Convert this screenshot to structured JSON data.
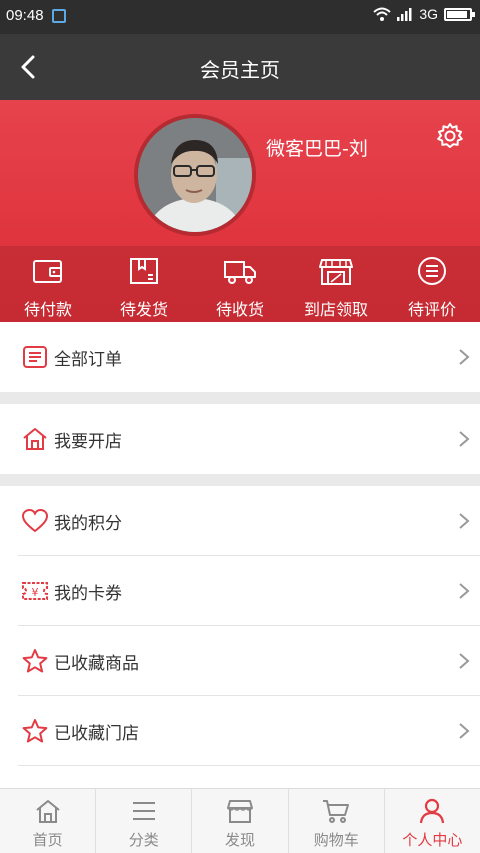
{
  "status_bar": {
    "time": "09:48",
    "network": "3G"
  },
  "nav": {
    "title": "会员主页"
  },
  "profile": {
    "username": "微客巴巴-刘",
    "orders": [
      {
        "label": "待付款",
        "icon": "wallet-icon"
      },
      {
        "label": "待发货",
        "icon": "package-icon"
      },
      {
        "label": "待收货",
        "icon": "truck-icon"
      },
      {
        "label": "到店领取",
        "icon": "store-icon"
      },
      {
        "label": "待评价",
        "icon": "comment-icon"
      }
    ]
  },
  "menu": {
    "all_orders": "全部订单",
    "open_store": "我要开店",
    "points": "我的积分",
    "coupons": "我的卡券",
    "fav_goods": "已收藏商品",
    "fav_stores": "已收藏门店"
  },
  "tabs": [
    {
      "label": "首页",
      "icon": "home-icon"
    },
    {
      "label": "分类",
      "icon": "menu-icon"
    },
    {
      "label": "发现",
      "icon": "shop-icon"
    },
    {
      "label": "购物车",
      "icon": "cart-icon"
    },
    {
      "label": "个人中心",
      "icon": "person-icon",
      "active": true
    }
  ],
  "colors": {
    "accent": "#e23b44",
    "header_red": "#e0353f",
    "nav_dark": "#3a3a3a"
  }
}
